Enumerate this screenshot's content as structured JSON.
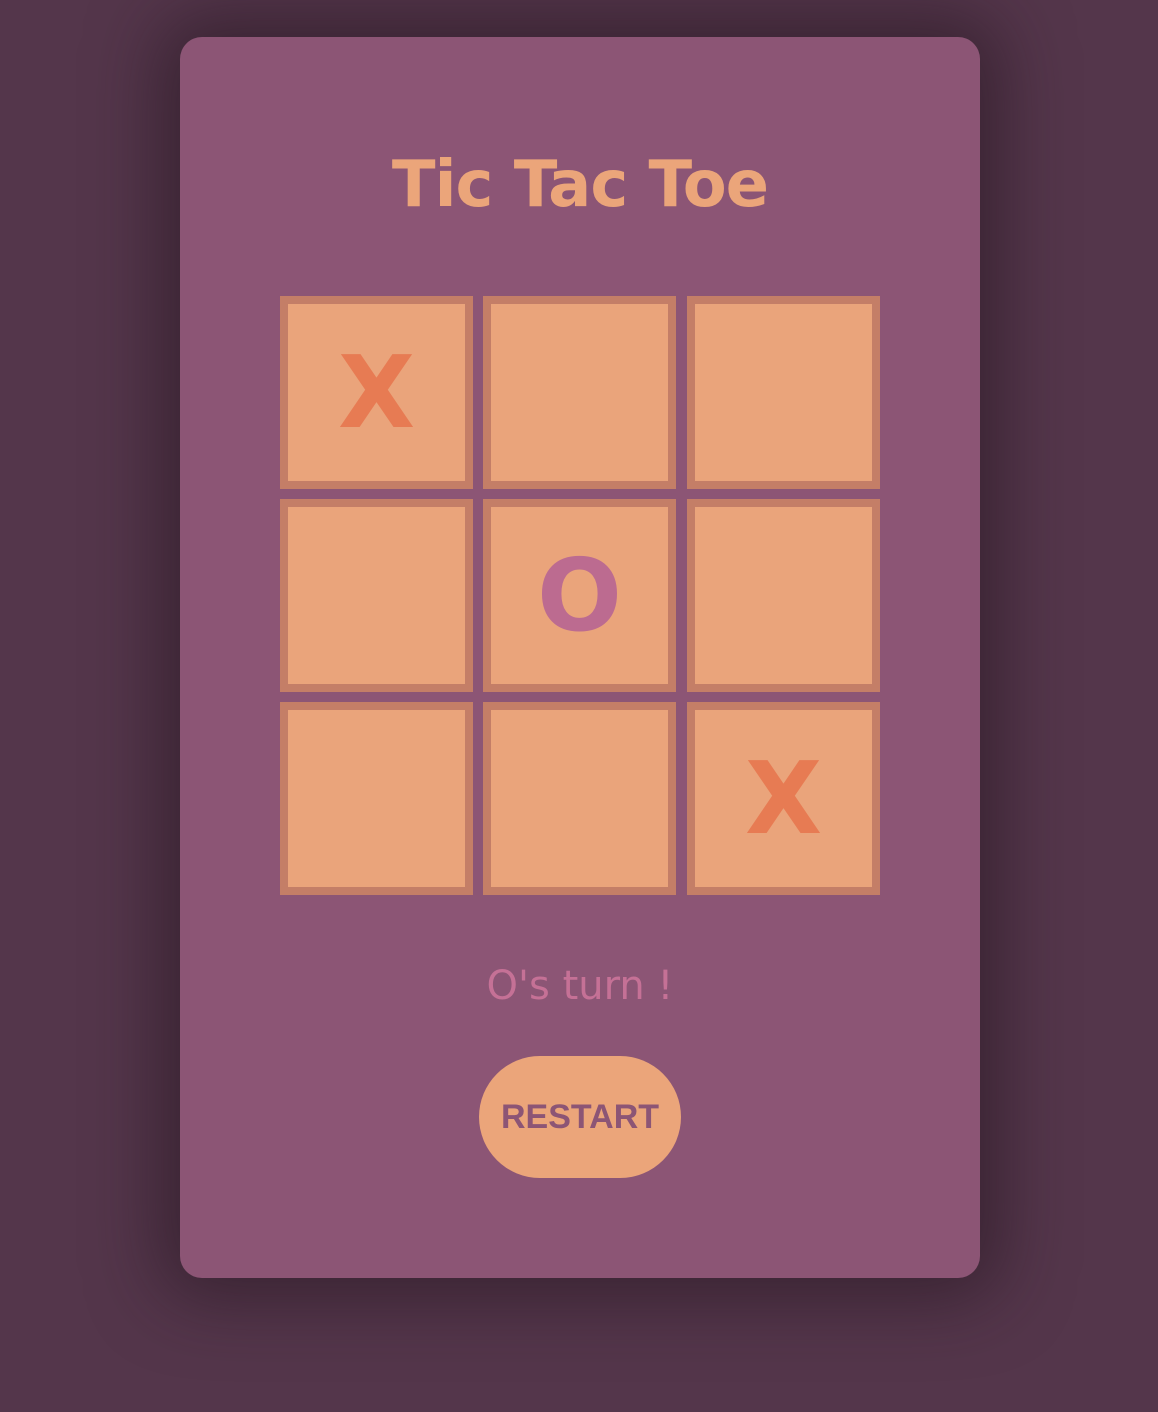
{
  "game": {
    "title": "Tic Tac Toe",
    "board": [
      "X",
      "",
      "",
      "",
      "O",
      "",
      "",
      "",
      "X"
    ],
    "status": "O's turn !",
    "restart_label": "RESTART"
  },
  "colors": {
    "page_background": "#54364b",
    "card_background": "#8c5575",
    "cell_fill": "#eaa47b",
    "cell_border": "#c47e67",
    "x_mark": "#e77b53",
    "o_mark": "#bc6b90",
    "title": "#eba57a",
    "status_text": "#c57196"
  }
}
